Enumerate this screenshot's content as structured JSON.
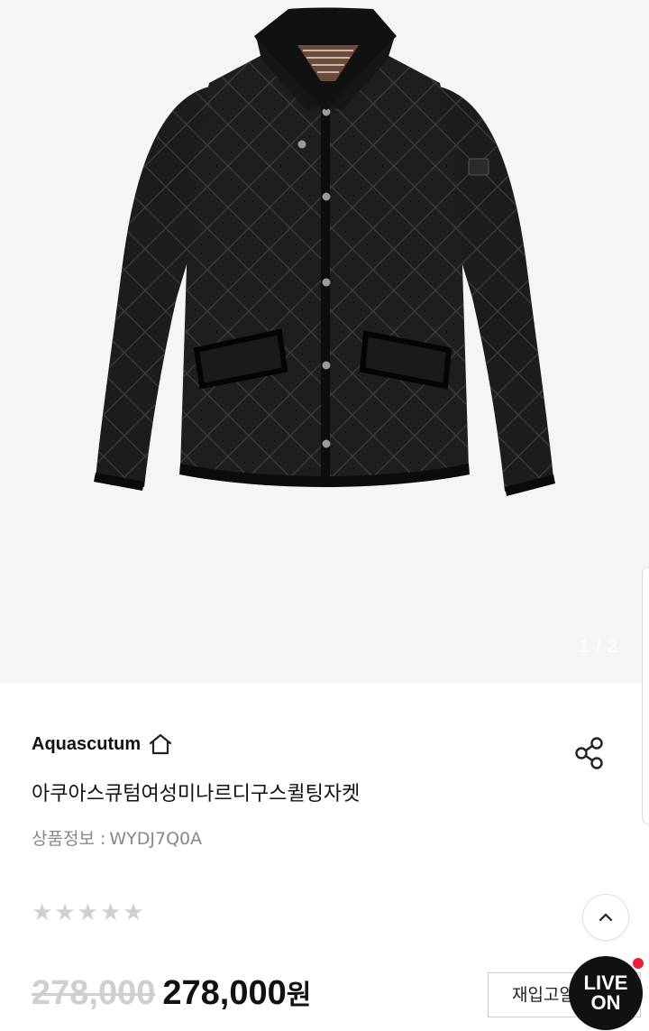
{
  "gallery": {
    "image_alt": "Aquascutum quilted jacket product photo",
    "counter": "1 / 2"
  },
  "product": {
    "brand": "Aquascutum",
    "name": "아쿠아스큐텀여성미나르디구스퀼팅자켓",
    "code_label": "상품정보 :",
    "code_value": "WYDJ7Q0A",
    "rating": {
      "stars_filled": 0,
      "stars_total": 5
    }
  },
  "price": {
    "original": "278,000",
    "sale": "278,000",
    "unit": "원"
  },
  "actions": {
    "restock_label": "재입고알림",
    "live_line1": "LIVE",
    "live_line2": "ON"
  },
  "colors": {
    "background": "#f5f5f5",
    "live_dot": "#e8213d",
    "strike_price": "#cfcfcf"
  },
  "icons": {
    "brand_home": "home-icon",
    "share": "share-icon",
    "scroll_top": "chevron-up-icon",
    "rating": "star-icon"
  }
}
